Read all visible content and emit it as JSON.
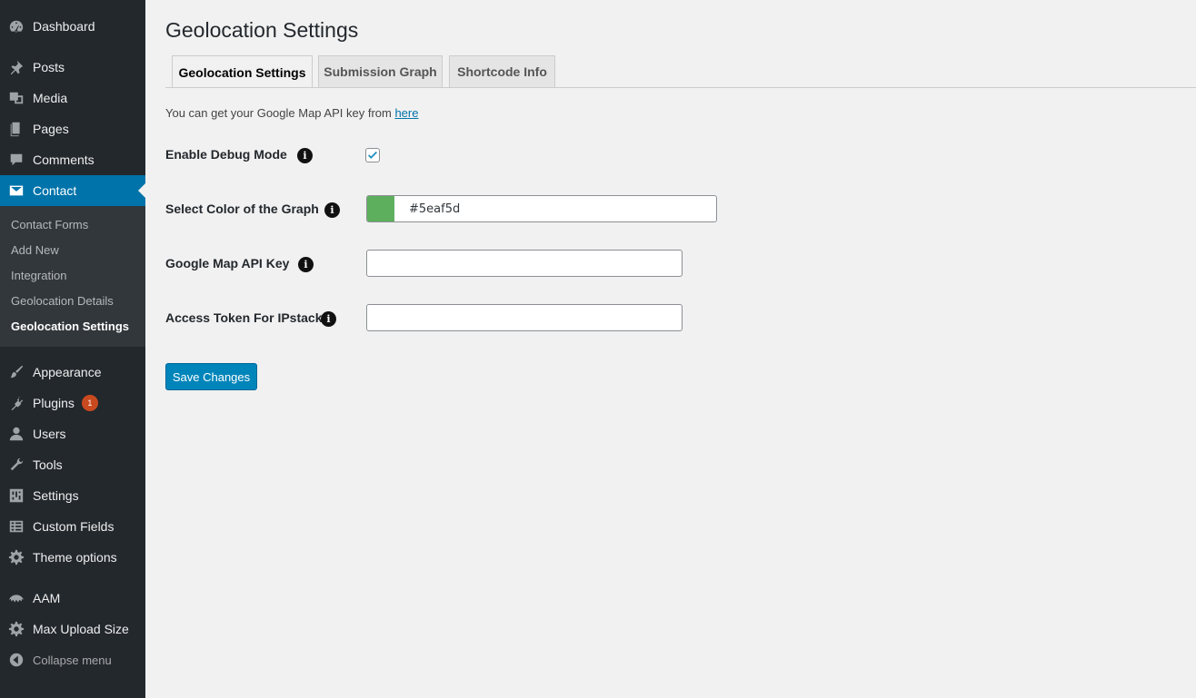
{
  "sidebar": {
    "dashboard": "Dashboard",
    "posts": "Posts",
    "media": "Media",
    "pages": "Pages",
    "comments": "Comments",
    "contact": "Contact",
    "contact_submenu": {
      "contact_forms": "Contact Forms",
      "add_new": "Add New",
      "integration": "Integration",
      "geolocation_details": "Geolocation Details",
      "geolocation_settings": "Geolocation Settings"
    },
    "appearance": "Appearance",
    "plugins": "Plugins",
    "plugins_badge": "1",
    "users": "Users",
    "tools": "Tools",
    "settings": "Settings",
    "custom_fields": "Custom Fields",
    "theme_options": "Theme options",
    "aam": "AAM",
    "max_upload_size": "Max Upload Size",
    "collapse_menu": "Collapse menu"
  },
  "page": {
    "title": "Geolocation Settings",
    "tabs": [
      "Geolocation Settings",
      "Submission Graph",
      "Shortcode Info"
    ],
    "intro_text": "You can get your Google Map API key from ",
    "intro_link": "here"
  },
  "form": {
    "debug_label": "Enable Debug Mode",
    "debug_checked": true,
    "color_label": "Select Color of the Graph",
    "color_value": "#5eaf5d",
    "api_key_label": "Google Map API Key",
    "api_key_value": "",
    "ipstack_label": "Access Token For IPstack",
    "ipstack_value": "",
    "save_label": "Save Changes"
  },
  "colors": {
    "sidebar_bg": "#23282d",
    "accent": "#0073aa",
    "swatch": "#5eaf5d",
    "badge": "#ca4a1f"
  }
}
